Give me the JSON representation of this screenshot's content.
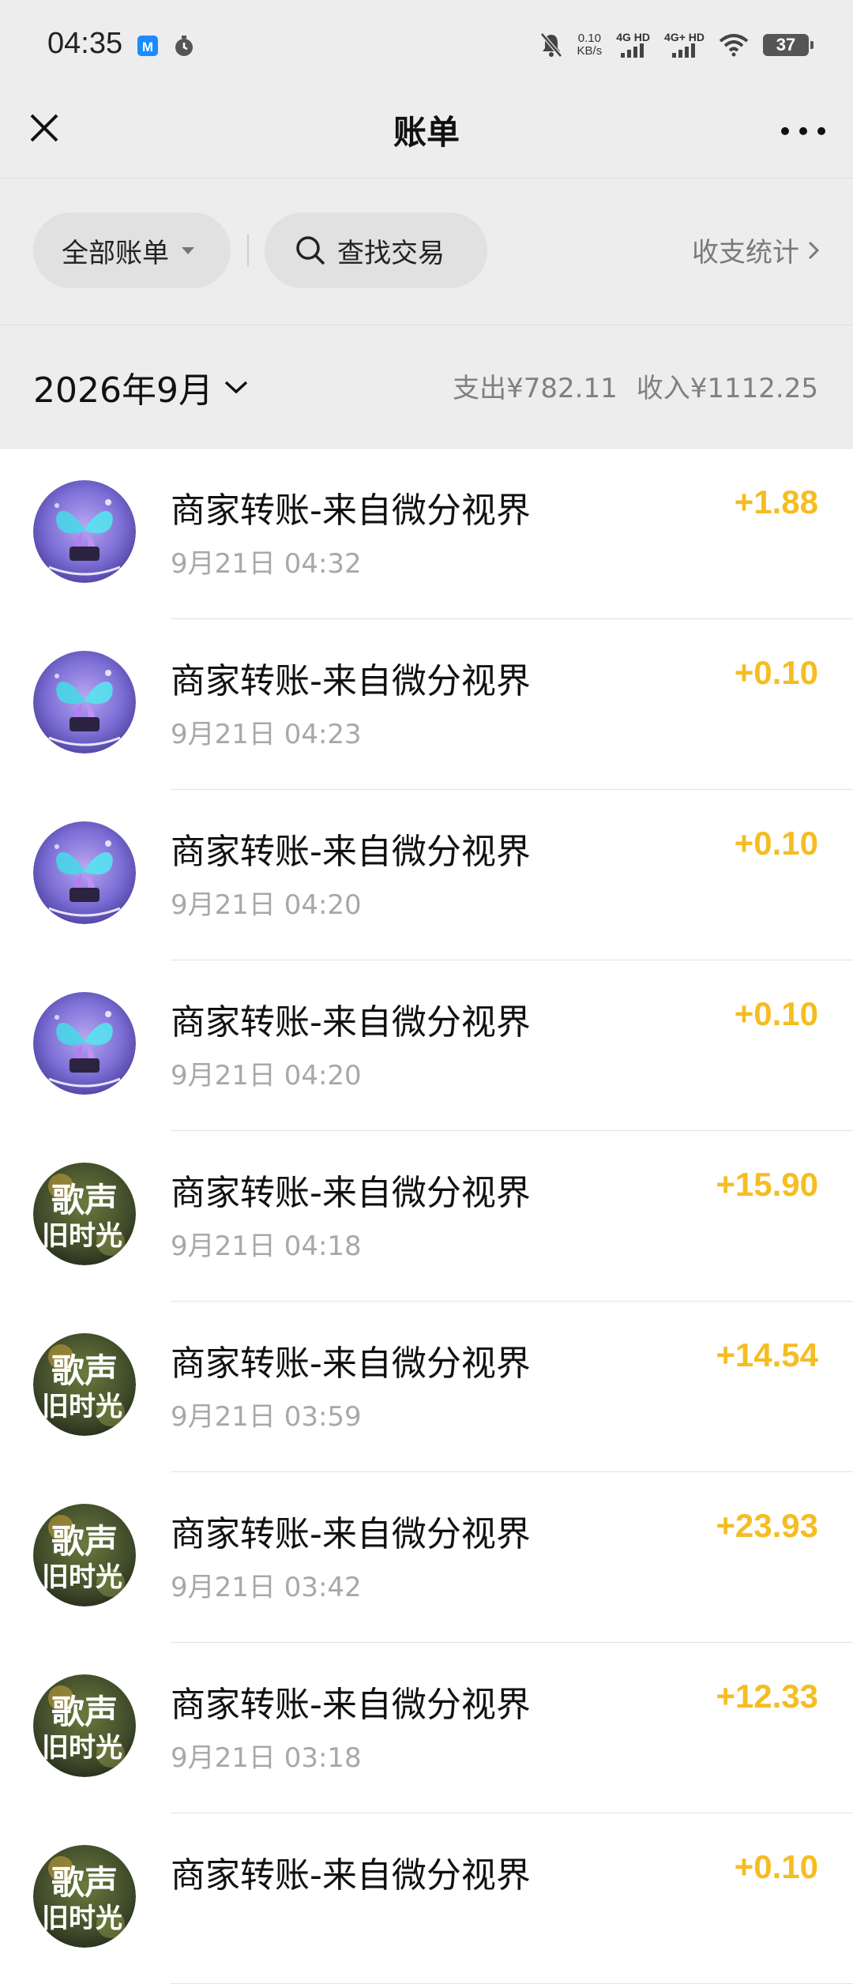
{
  "status_bar": {
    "time": "04:35",
    "net_speed_value": "0.10",
    "net_speed_unit": "KB/s",
    "sim1_label": "4G HD",
    "sim2_label": "4G+ HD",
    "battery": "37",
    "icons": [
      "maps-app-icon",
      "timer-icon",
      "mute-bell-icon",
      "signal-icon",
      "wifi-icon",
      "battery-icon"
    ]
  },
  "nav": {
    "title": "账单"
  },
  "filters": {
    "all_bills": "全部账单",
    "search": "查找交易",
    "stats": "收支统计"
  },
  "month": {
    "label": "2026年9月",
    "expense": "支出¥782.11",
    "income": "收入¥1112.25"
  },
  "transactions": [
    {
      "title": "商家转账-来自微分视界",
      "time": "9月21日 04:32",
      "amount": "+1.88",
      "avatar": "butterfly"
    },
    {
      "title": "商家转账-来自微分视界",
      "time": "9月21日 04:23",
      "amount": "+0.10",
      "avatar": "butterfly"
    },
    {
      "title": "商家转账-来自微分视界",
      "time": "9月21日 04:20",
      "amount": "+0.10",
      "avatar": "butterfly"
    },
    {
      "title": "商家转账-来自微分视界",
      "time": "9月21日 04:20",
      "amount": "+0.10",
      "avatar": "butterfly"
    },
    {
      "title": "商家转账-来自微分视界",
      "time": "9月21日 04:18",
      "amount": "+15.90",
      "avatar": "song"
    },
    {
      "title": "商家转账-来自微分视界",
      "time": "9月21日 03:59",
      "amount": "+14.54",
      "avatar": "song"
    },
    {
      "title": "商家转账-来自微分视界",
      "time": "9月21日 03:42",
      "amount": "+23.93",
      "avatar": "song"
    },
    {
      "title": "商家转账-来自微分视界",
      "time": "9月21日 03:18",
      "amount": "+12.33",
      "avatar": "song"
    },
    {
      "title": "商家转账-来自微分视界",
      "time": "",
      "amount": "+0.10",
      "avatar": "song"
    }
  ],
  "avatar_text": {
    "line1": "歌声",
    "line2": "旧时光"
  },
  "colors": {
    "amount": "#f5bd22",
    "header_bg": "#ededed"
  }
}
